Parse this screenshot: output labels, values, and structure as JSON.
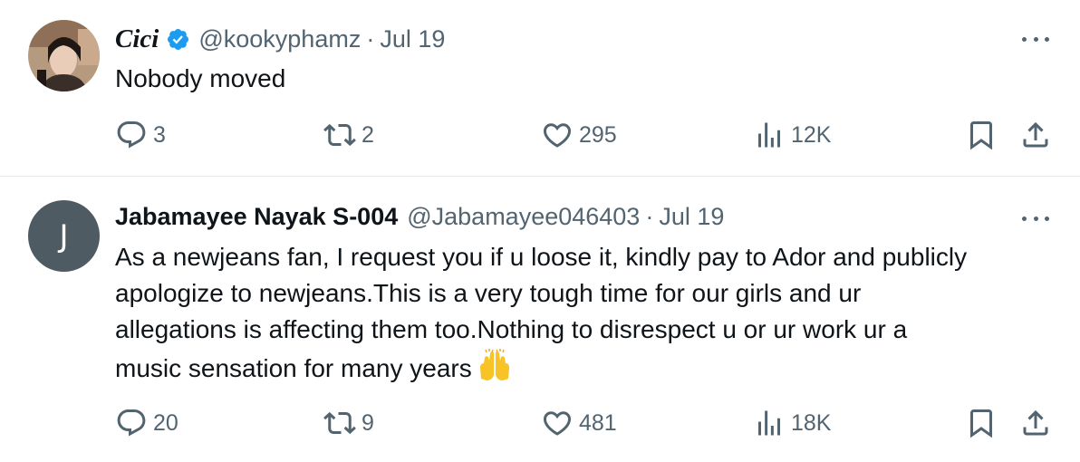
{
  "tweets": [
    {
      "name": "Cici",
      "handle": "@kookyphamz",
      "separator": "·",
      "date": "Jul 19",
      "verified": true,
      "text_lines": [
        "Nobody moved"
      ],
      "replies": "3",
      "retweets": "2",
      "likes": "295",
      "views": "12K"
    },
    {
      "name": "Jabamayee Nayak S-004",
      "handle": "@Jabamayee046403",
      "separator": "·",
      "date": "Jul 19",
      "verified": false,
      "avatar_letter": "J",
      "text_lines": [
        "As a newjeans fan, I request you if u loose it, kindly pay to Ador and publicly",
        "apologize to newjeans.This is a very tough time for our girls and ur",
        "allegations is affecting them too.Nothing to disrespect u or ur work ur a",
        "music sensation for many years"
      ],
      "emoji": "🙌",
      "replies": "20",
      "retweets": "9",
      "likes": "481",
      "views": "18K"
    }
  ],
  "colors": {
    "text": "#0f1419",
    "muted": "#536471",
    "verified": "#1d9bf0",
    "divider": "#e6e9ec",
    "avatar_bg": "#4f5b62"
  }
}
